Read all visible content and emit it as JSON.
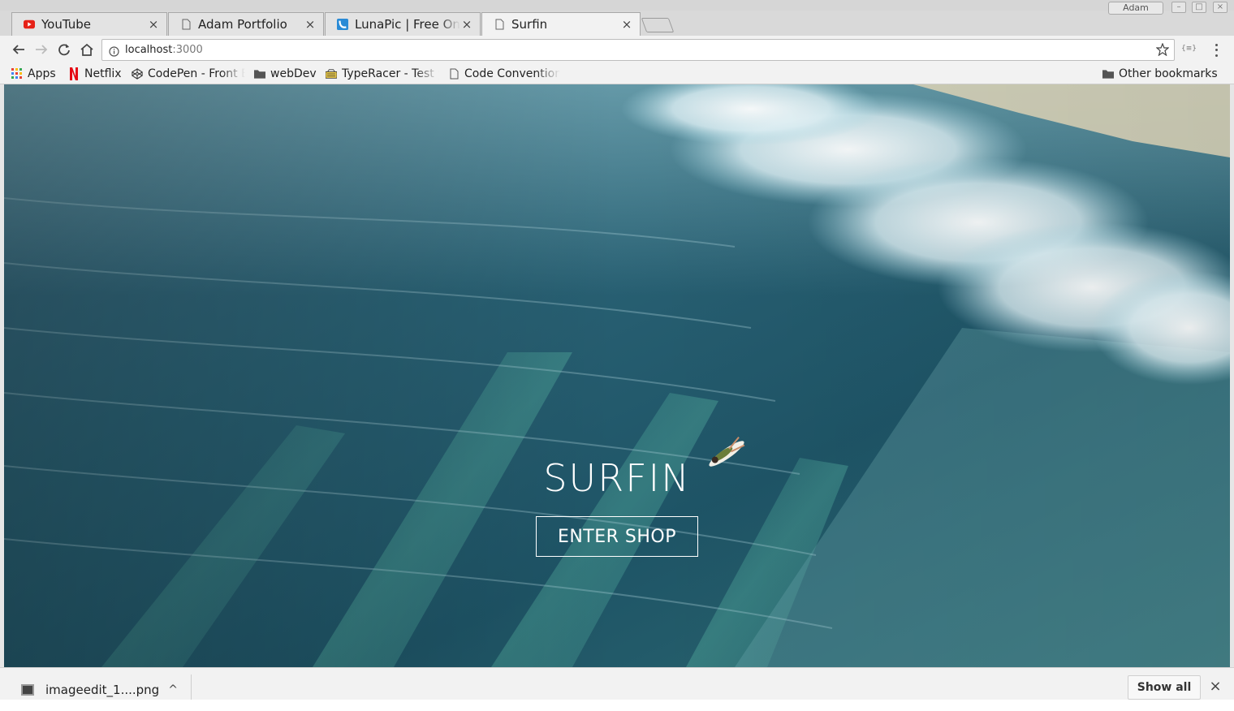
{
  "browser": {
    "tabs": [
      {
        "label": "YouTube",
        "icon": "youtube-icon",
        "close": "×",
        "active": false
      },
      {
        "label": "Adam Portfolio",
        "icon": "page-icon",
        "close": "×",
        "active": false
      },
      {
        "label": "LunaPic | Free Online",
        "icon": "lunapic-icon",
        "close": "×",
        "active": false
      },
      {
        "label": "Surfin",
        "icon": "page-icon",
        "close": "×",
        "active": true
      }
    ],
    "profile_label": "Adam",
    "address": {
      "host": "localhost",
      "port": ":3000"
    },
    "extension_label": "{≡}"
  },
  "bookmarks": {
    "items": [
      {
        "label": "Apps",
        "icon": "apps-grid-icon"
      },
      {
        "label": "Netflix",
        "icon": "netflix-icon"
      },
      {
        "label": "CodePen - Front End",
        "icon": "codepen-icon"
      },
      {
        "label": "webDev",
        "icon": "folder-icon"
      },
      {
        "label": "TypeRacer - Test your",
        "icon": "typeracer-icon"
      },
      {
        "label": "Code Conventions",
        "icon": "page-icon"
      }
    ],
    "other": {
      "label": "Other bookmarks",
      "icon": "folder-icon"
    }
  },
  "page": {
    "title": "SURFIN",
    "cta_label": "ENTER SHOP"
  },
  "downloads": {
    "file_name": "imageedit_1....png",
    "caret": "^",
    "show_all_label": "Show all",
    "close": "×"
  },
  "colors": {
    "ocean_deep": "#1f4f66",
    "ocean_teal": "#3d8a8c",
    "foam": "#e8f4f7",
    "netflix_red": "#e50914",
    "youtube_red": "#e62117"
  }
}
